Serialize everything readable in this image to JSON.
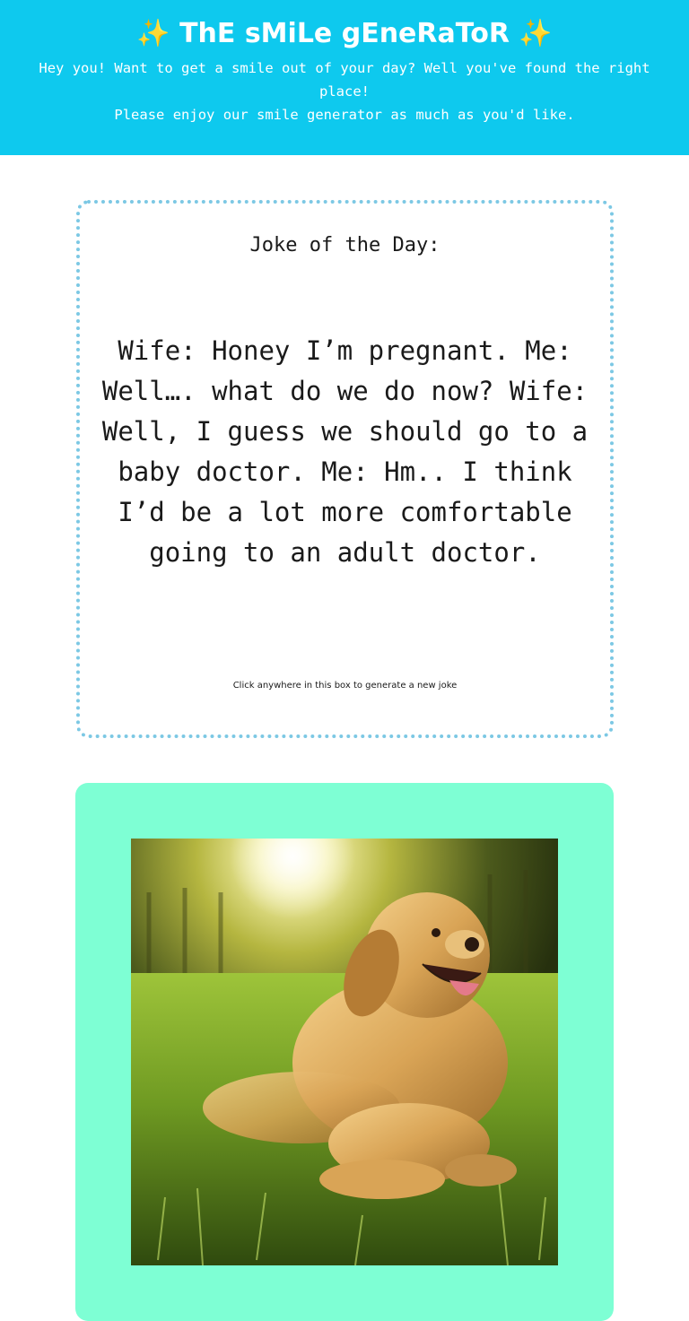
{
  "header": {
    "title_sparkle_left": "✨",
    "title": "ThE sMiLe gEneRaToR",
    "title_sparkle_right": "✨",
    "subtitle_line1": "Hey you! Want to get a smile out of your day? Well you've found the right place!",
    "subtitle_line2": "Please enjoy our smile generator as much as you'd like."
  },
  "joke": {
    "heading": "Joke of the Day:",
    "text": "Wife: Honey I’m pregnant. Me: Well…. what do we do now? Wife: Well, I guess we should go to a baby doctor. Me: Hm.. I think I’d be a lot more comfortable going to an adult doctor.",
    "hint": "Click anywhere in this box to generate a new joke"
  },
  "image": {
    "alt": "golden retriever lying in sunny grass"
  },
  "colors": {
    "header_bg": "#0ec9ee",
    "joke_border": "#7cc8e4",
    "image_card_bg": "#7effd4"
  }
}
